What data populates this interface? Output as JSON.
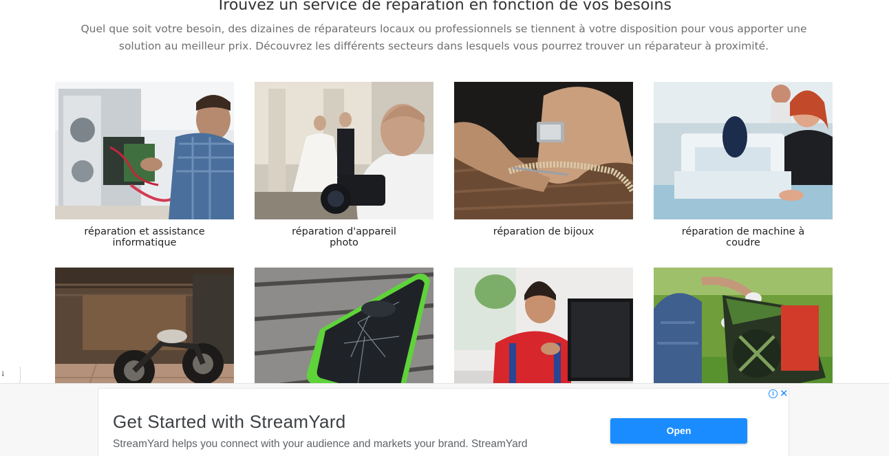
{
  "section": {
    "title": "Trouvez un service de réparation en fonction de vos besoins",
    "intro": "Quel que soit votre besoin, des dizaines de réparateurs locaux ou professionnels se tiennent à votre disposition pour vous apporter une solution au meilleur prix. Découvrez les différents secteurs dans lesquels vous pourrez trouver un réparateur à proximité."
  },
  "categories": [
    {
      "label": "réparation et assistance informatique",
      "image": "computer-repair-photo"
    },
    {
      "label": "réparation d'appareil photo",
      "image": "camera-repair-photo"
    },
    {
      "label": "réparation de bijoux",
      "image": "jewelry-repair-photo"
    },
    {
      "label": "réparation de machine à coudre",
      "image": "sewing-machine-repair-photo"
    },
    {
      "label": "",
      "image": "motorcycle-garage-photo"
    },
    {
      "label": "",
      "image": "broken-phone-photo"
    },
    {
      "label": "",
      "image": "technician-laptop-photo"
    },
    {
      "label": "",
      "image": "lawn-mower-repair-photo"
    }
  ],
  "ad": {
    "title": "Get Started with StreamYard",
    "description": "StreamYard helps you connect with your audience and markets your brand. StreamYard",
    "button_label": "Open",
    "info_icon": "info-icon",
    "close_icon": "close-icon",
    "close_glyph": "✕",
    "info_glyph": "i",
    "accent_color": "#1a8cff"
  },
  "side_tab": {
    "glyph": "✓"
  }
}
